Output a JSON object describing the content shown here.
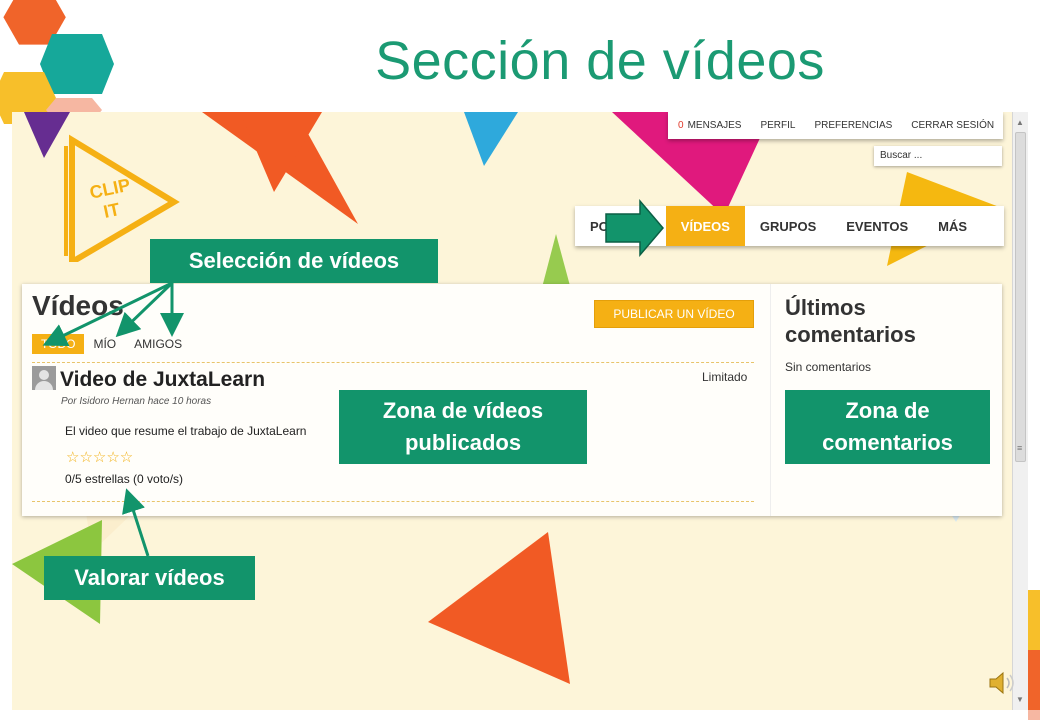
{
  "slide": {
    "title": "Sección de vídeos"
  },
  "site": {
    "logo_text_top": "CLIP",
    "logo_text_bottom": "IT",
    "top_menu": {
      "message_count": "0",
      "messages_label": "MENSAJES",
      "profile_label": "PERFIL",
      "preferences_label": "PREFERENCIAS",
      "logout_label": "CERRAR SESIÓN"
    },
    "search_placeholder": "Buscar ...",
    "main_nav": [
      {
        "label": "PO"
      },
      {
        "label": "VÍDEOS",
        "active": true
      },
      {
        "label": "GRUPOS"
      },
      {
        "label": "EVENTOS"
      },
      {
        "label": "MÁS"
      }
    ]
  },
  "videos_panel": {
    "heading": "Vídeos",
    "publish_button": "PUBLICAR UN VÍDEO",
    "tabs": [
      {
        "label": "TODO",
        "active": true
      },
      {
        "label": "MÍO"
      },
      {
        "label": "AMIGOS"
      }
    ],
    "video": {
      "title": "Video de JuxtaLearn",
      "access": "Limitado",
      "byline": "Por Isidoro Hernan hace 10 horas",
      "description": "El video que resume el trabajo de JuxtaLearn",
      "stars": "☆☆☆☆☆",
      "rating_text": "0/5 estrellas (0 voto/s)",
      "rating": 0
    }
  },
  "comments_panel": {
    "heading": "Últimos comentarios",
    "empty_text": "Sin comentarios"
  },
  "callouts": {
    "video_selection": "Selección de vídeos",
    "published_zone": "Zona de vídeos publicados",
    "comments_zone": "Zona de comentarios",
    "rate_videos": "Valorar vídeos"
  },
  "colors": {
    "title_green": "#1b9a73",
    "callout_green": "#12946b",
    "accent_yellow": "#f5b014",
    "triangle_orange": "#f15a24",
    "triangle_magenta": "#e0197d",
    "triangle_lime": "#8cc63f",
    "triangle_blue": "#29abe2",
    "triangle_purple": "#662d91",
    "page_bg": "#fdf5d9"
  },
  "icons": [
    "hexagon-decoration",
    "play-triangle-logo",
    "avatar-icon",
    "star-icon",
    "speaker-icon",
    "arrow-right-icon"
  ]
}
